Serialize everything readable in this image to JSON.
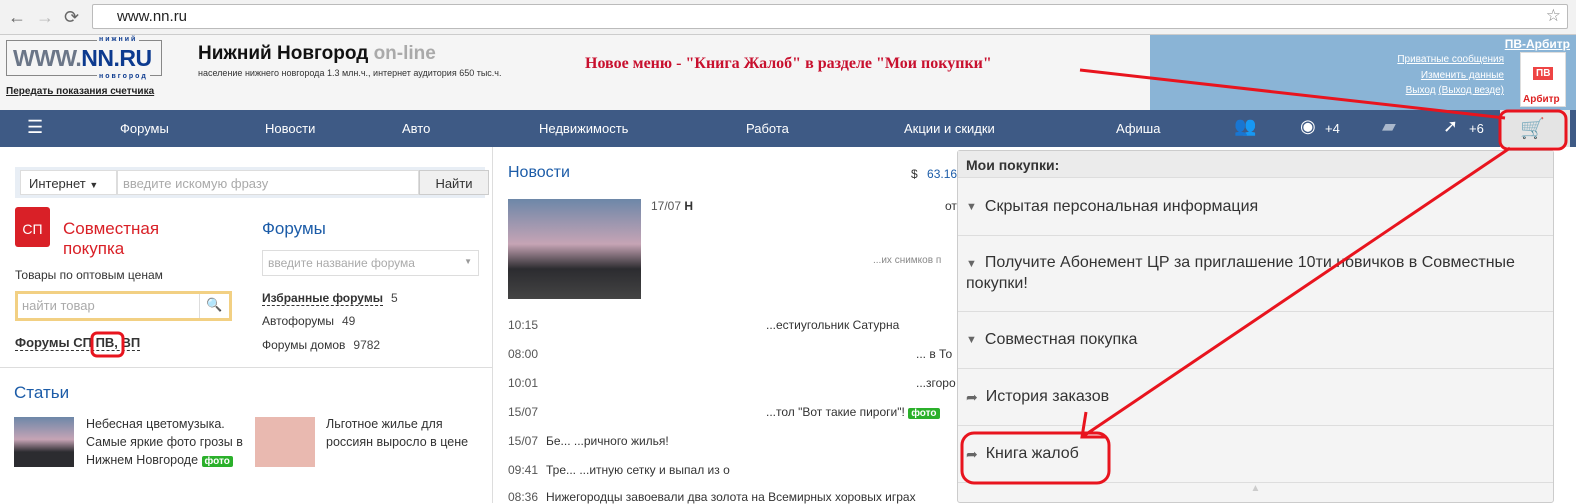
{
  "browser": {
    "url": "www.nn.ru",
    "back": "←",
    "forward": "→",
    "reload": "⟳",
    "star": "☆"
  },
  "header": {
    "logo_main": "WWW.",
    "logo_nn": "NN.RU",
    "logo_top": "нижний",
    "logo_bottom": "новгород",
    "title": "Нижний Новгород",
    "title_suffix": "on-line",
    "subtitle": "население нижнего новгорода 1.3 млн.ч., интернет аудитория 650 тыс.ч.",
    "meter_link": "Передать показания счетчика",
    "promo": "Новое меню - \"Книга Жалоб\" в разделе \"Мои покупки\"",
    "user": {
      "name": "ПВ-Арбитр",
      "private_messages": "Приватные сообщения",
      "edit_data": "Изменить данные",
      "logout": "Выход",
      "logout_all": "(Выход везде)",
      "avatar_pv": "ПВ",
      "avatar_label": "Арбитр"
    }
  },
  "nav": {
    "items": [
      "Форумы",
      "Новости",
      "Авто",
      "Недвижимость",
      "Работа",
      "Акции и скидки",
      "Афиша"
    ],
    "views": "+4",
    "rating": "+6"
  },
  "search": {
    "scope": "Интернет",
    "placeholder": "введите искомую фразу",
    "button": "Найти"
  },
  "sp": {
    "icon": "СП",
    "title1": "Совместная",
    "title2": "покупка",
    "subtitle": "Товары по оптовым ценам",
    "placeholder": "найти товар",
    "forums_label": "Форумы СП",
    "forums_pv": "ПВ,",
    "forums_vp": "ВП"
  },
  "forums": {
    "title": "Форумы",
    "placeholder": "введите название форума",
    "rows": [
      {
        "label": "Избранные форумы",
        "count": "5"
      },
      {
        "label": "Автофорумы",
        "count": "49"
      },
      {
        "label": "Форумы домов",
        "count": "9782"
      }
    ]
  },
  "articles": {
    "title": "Статьи",
    "items": [
      {
        "text": "Небесная цветомузыка. Самые яркие фото грозы в Нижнем Новгороде",
        "badge": "фото"
      },
      {
        "text": "Льготное жилье для россиян выросло в цене"
      }
    ]
  },
  "news": {
    "title": "Новости",
    "currency": "$",
    "rate": "63.16",
    "top": {
      "date": "17/07",
      "head": "Н",
      "frag1": "от",
      "frag2": "...их снимков п"
    },
    "rows": [
      {
        "time": "10:15",
        "text": "...естиугольник Сатурна"
      },
      {
        "time": "08:00",
        "text": "... в То"
      },
      {
        "time": "10:01",
        "text": "...згоро"
      },
      {
        "time": "15/07",
        "text": "...тол \"Вот такие пироги\"!",
        "badge": "фото"
      },
      {
        "time": "15/07",
        "text": "Бе... ...ричного жилья!"
      },
      {
        "time": "09:41",
        "text": "Тре... ...итную сетку и выпал из о"
      },
      {
        "time": "08:36",
        "text": "Нижегородцы завоевали два золота на Всемирных хоровых играх"
      }
    ]
  },
  "my_purchases": {
    "title": "Мои покупки:",
    "items": [
      {
        "label": "Скрытая персональная информация",
        "icon": "chevron-down"
      },
      {
        "label": "Получите Абонемент ЦР за приглашение 10ти новичков в Совместные покупки!",
        "icon": "chevron-down"
      },
      {
        "label": "Совместная покупка",
        "icon": "chevron-down"
      },
      {
        "label": "История заказов",
        "icon": "share-arrow"
      },
      {
        "label": "Книга жалоб",
        "icon": "share-arrow"
      }
    ]
  },
  "colors": {
    "nav": "#3e5a85",
    "accent_red": "#d92027",
    "link_blue": "#1c5ca8",
    "annotation": "#e8141e"
  }
}
